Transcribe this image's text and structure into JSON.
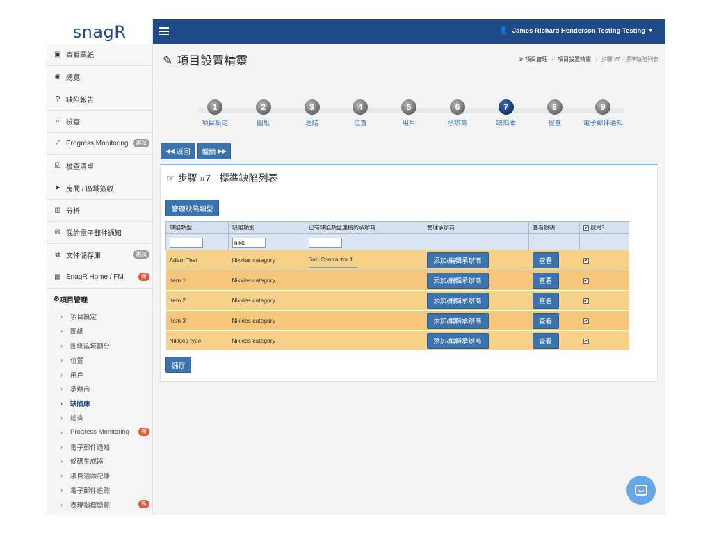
{
  "brand": {
    "logo_text": "snagR"
  },
  "topbar": {
    "user_name": "James Richard Henderson Testing Testing"
  },
  "sidebar": {
    "items": [
      {
        "label": "查看圖紙",
        "icon": "image-icon"
      },
      {
        "label": "總覽",
        "icon": "dashboard-icon"
      },
      {
        "label": "缺陷報告",
        "icon": "pin-icon"
      },
      {
        "label": "檢查",
        "icon": "search-icon"
      },
      {
        "label": "Progress Monitoring",
        "icon": "chart-icon",
        "badge": "測試"
      },
      {
        "label": "檢查清單",
        "icon": "checkbox-icon"
      },
      {
        "label": "房間 / 區域簽收",
        "icon": "send-icon"
      },
      {
        "label": "分析",
        "icon": "bar-chart-icon"
      },
      {
        "label": "我的電子郵件通知",
        "icon": "envelope-icon"
      },
      {
        "label": "文件儲存庫",
        "icon": "copy-icon",
        "badge": "測試"
      },
      {
        "label": "SnagR Home / FM",
        "icon": "building-icon",
        "badge": "新"
      }
    ],
    "section_head": "項目管理",
    "sub_items": [
      {
        "label": "項目設定"
      },
      {
        "label": "圖紙"
      },
      {
        "label": "圖紙區域劃分"
      },
      {
        "label": "位置"
      },
      {
        "label": "用戶"
      },
      {
        "label": "承辦商"
      },
      {
        "label": "缺陷庫"
      },
      {
        "label": "檢查"
      },
      {
        "label": "Progress Monitoring",
        "badge": "新"
      },
      {
        "label": "電子郵件通知"
      },
      {
        "label": "條碼生成器"
      },
      {
        "label": "項目活動記錄"
      },
      {
        "label": "電子郵件追踪"
      },
      {
        "label": "表現指標總覽",
        "badge": "新"
      }
    ]
  },
  "page": {
    "title": "項目設置精靈",
    "breadcrumb": [
      "項目管理",
      "項目設置精靈",
      "步驟 #7 - 標準缺陷列表"
    ]
  },
  "steps": [
    {
      "num": "1",
      "label": "項目設定"
    },
    {
      "num": "2",
      "label": "圖紙"
    },
    {
      "num": "3",
      "label": "連結"
    },
    {
      "num": "4",
      "label": "位置"
    },
    {
      "num": "5",
      "label": "用戶"
    },
    {
      "num": "6",
      "label": "承辦商"
    },
    {
      "num": "7",
      "label": "缺陷庫"
    },
    {
      "num": "8",
      "label": "檢查"
    },
    {
      "num": "9",
      "label": "電子郵件通知"
    }
  ],
  "actions": {
    "back_label": "返回",
    "next_label": "繼續"
  },
  "panel": {
    "title": "步驟 #7 - 標準缺陷列表",
    "manage_label": "管理缺陷類型",
    "save_label": "儲存"
  },
  "table": {
    "headers": [
      "缺陷類型",
      "缺陷類別",
      "已有缺陷類型連接的承辦商",
      "管理承辦商",
      "查看說明",
      "啟用？"
    ],
    "filters": {
      "type": "",
      "category": "nikki",
      "contractor": ""
    },
    "add_label": "添加/編輯承辦商",
    "view_label": "查看",
    "rows": [
      {
        "type": "Adam Test",
        "category": "Nikkies category",
        "contractor": "Sub Contractor 1",
        "enabled": true
      },
      {
        "type": "Item 1",
        "category": "Nikkies category",
        "contractor": "",
        "enabled": true
      },
      {
        "type": "Item 2",
        "category": "Nikkies category",
        "contractor": "",
        "enabled": true
      },
      {
        "type": "Item 3",
        "category": "Nikkies category",
        "contractor": "",
        "enabled": true
      },
      {
        "type": "Nikkies type",
        "category": "Nikkies category",
        "contractor": "",
        "enabled": true
      }
    ]
  },
  "colors": {
    "topbar": "#1e4a87",
    "active_step": "#1e4a87",
    "row_highlight": "#f6c77a",
    "button": "#3a73ad"
  }
}
